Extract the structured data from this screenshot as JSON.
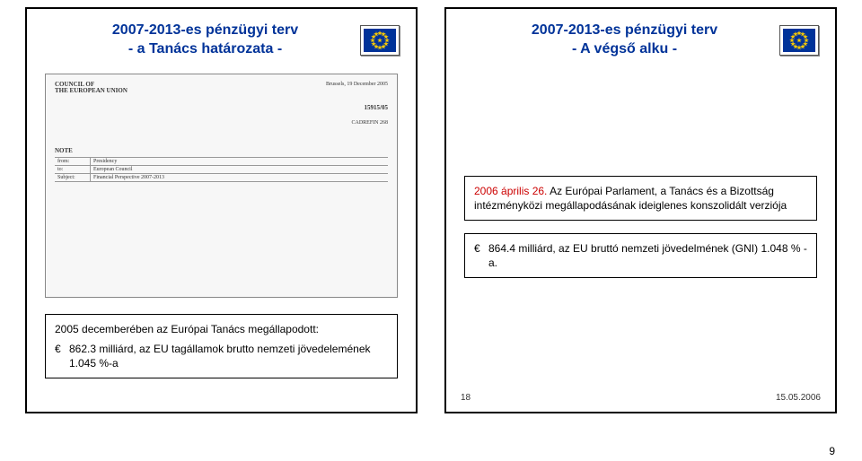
{
  "page_number": "9",
  "left_slide": {
    "title_line1": "2007-2013-es pénzügyi terv",
    "title_line2": "- a Tanács határozata -",
    "doc_header_left": "COUNCIL OF\nTHE EUROPEAN UNION",
    "doc_header_right": "Brussels, 19 December 2005",
    "doc_number": "15915/05",
    "doc_code": "CADREFIN 268",
    "doc_note_label": "NOTE",
    "doc_from_label": "from:",
    "doc_from_value": "Presidency",
    "doc_to_label": "to:",
    "doc_to_value": "European Council",
    "doc_subject_label": "Subject:",
    "doc_subject_value": "Financial Perspective 2007-2013",
    "box_lead": "2005 decemberében az Európai Tanács megállapodott:",
    "box_bullet": "862.3 milliárd,  az EU tagállamok brutto nemzeti jövedelemének 1.045 %-a"
  },
  "right_slide": {
    "title_line1": "2007-2013-es pénzügyi terv",
    "title_line2": "- A végső alku -",
    "box1_red": "2006 április 26.",
    "box1_rest": " Az Európai Parlament, a Tanács és a Bizottság intézményközi megállapodásának ideiglenes konszolidált verziója",
    "box2_bullet": "864.4 milliárd, az EU bruttó nemzeti jövedelmének (GNI) 1.048 % -a.",
    "footer_page": "18",
    "footer_date": "15.05.2006"
  }
}
